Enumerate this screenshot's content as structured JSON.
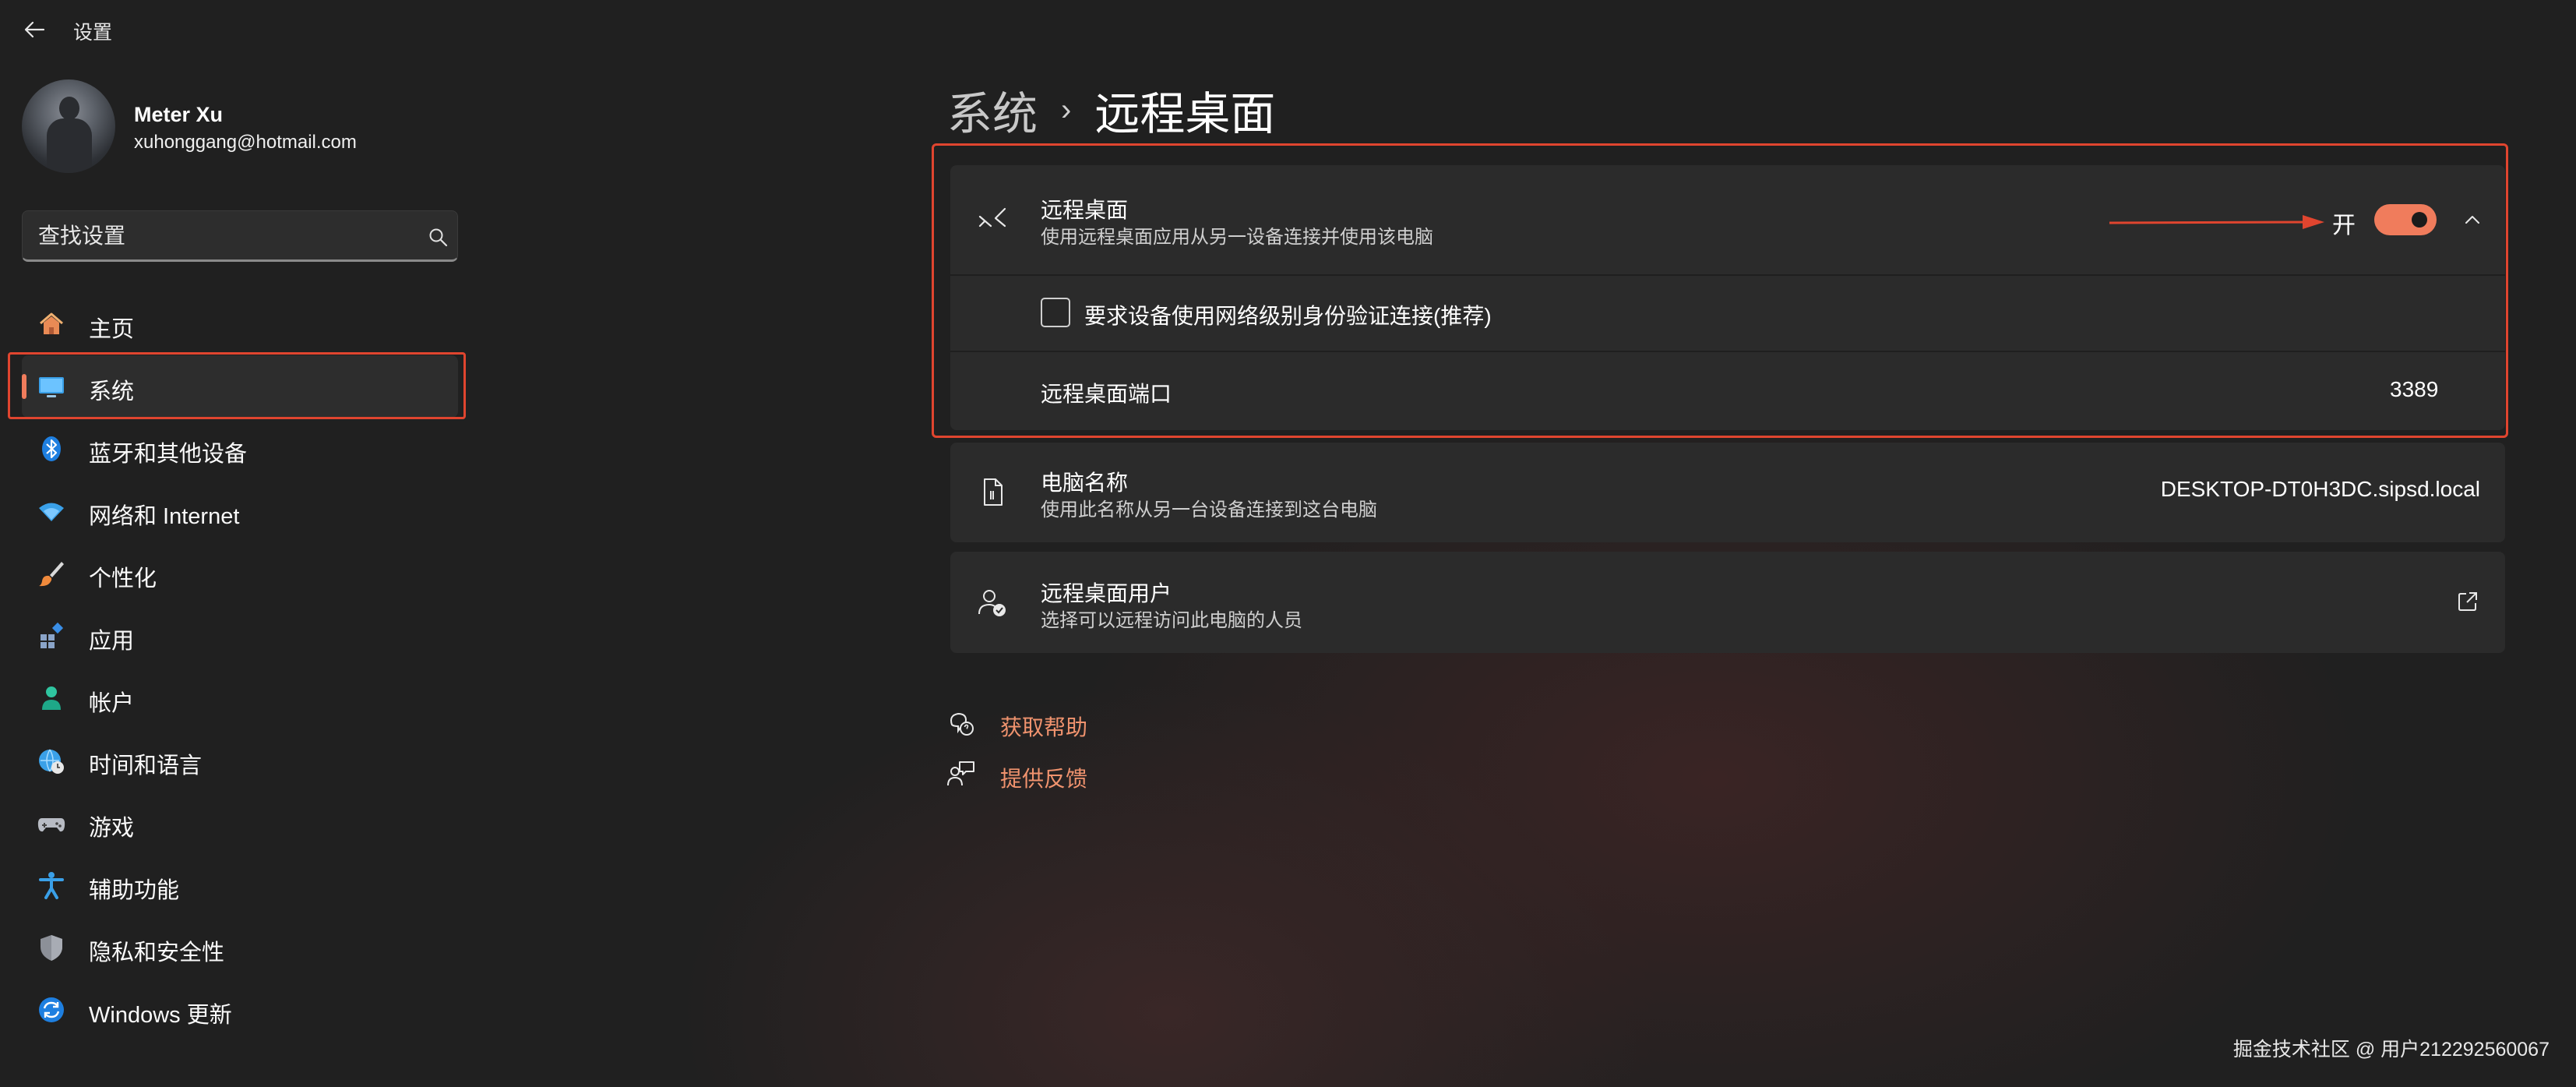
{
  "app": {
    "title": "设置"
  },
  "profile": {
    "name": "Meter Xu",
    "email": "xuhonggang@hotmail.com"
  },
  "search": {
    "placeholder": "查找设置"
  },
  "nav": {
    "items": [
      {
        "label": "主页",
        "icon": "home-icon"
      },
      {
        "label": "系统",
        "icon": "monitor-icon",
        "selected": true
      },
      {
        "label": "蓝牙和其他设备",
        "icon": "bluetooth-icon"
      },
      {
        "label": "网络和 Internet",
        "icon": "wifi-icon"
      },
      {
        "label": "个性化",
        "icon": "brush-icon"
      },
      {
        "label": "应用",
        "icon": "apps-icon"
      },
      {
        "label": "帐户",
        "icon": "account-icon"
      },
      {
        "label": "时间和语言",
        "icon": "globe-clock-icon"
      },
      {
        "label": "游戏",
        "icon": "gamepad-icon"
      },
      {
        "label": "辅助功能",
        "icon": "accessibility-icon"
      },
      {
        "label": "隐私和安全性",
        "icon": "shield-icon"
      },
      {
        "label": "Windows 更新",
        "icon": "update-icon"
      }
    ]
  },
  "breadcrumb": {
    "parent": "系统",
    "separator": "›",
    "current": "远程桌面"
  },
  "remote_desktop": {
    "title": "远程桌面",
    "description": "使用远程桌面应用从另一设备连接并使用该电脑",
    "toggle_state_text": "开",
    "toggle_on": true,
    "nla_label": "要求设备使用网络级别身份验证连接(推荐)",
    "nla_checked": false,
    "port_label": "远程桌面端口",
    "port_value": "3389"
  },
  "pc_name": {
    "title": "电脑名称",
    "description": "使用此名称从另一台设备连接到这台电脑",
    "value": "DESKTOP-DT0H3DC.sipsd.local"
  },
  "remote_users": {
    "title": "远程桌面用户",
    "description": "选择可以远程访问此电脑的人员"
  },
  "links": {
    "help": "获取帮助",
    "feedback": "提供反馈"
  },
  "watermark": "掘金技术社区 @ 用户212292560067",
  "colors": {
    "accent": "#f07c5c",
    "annotation_red": "#e0452f",
    "card_bg": "#2b2b2b",
    "link": "#f0936e"
  }
}
